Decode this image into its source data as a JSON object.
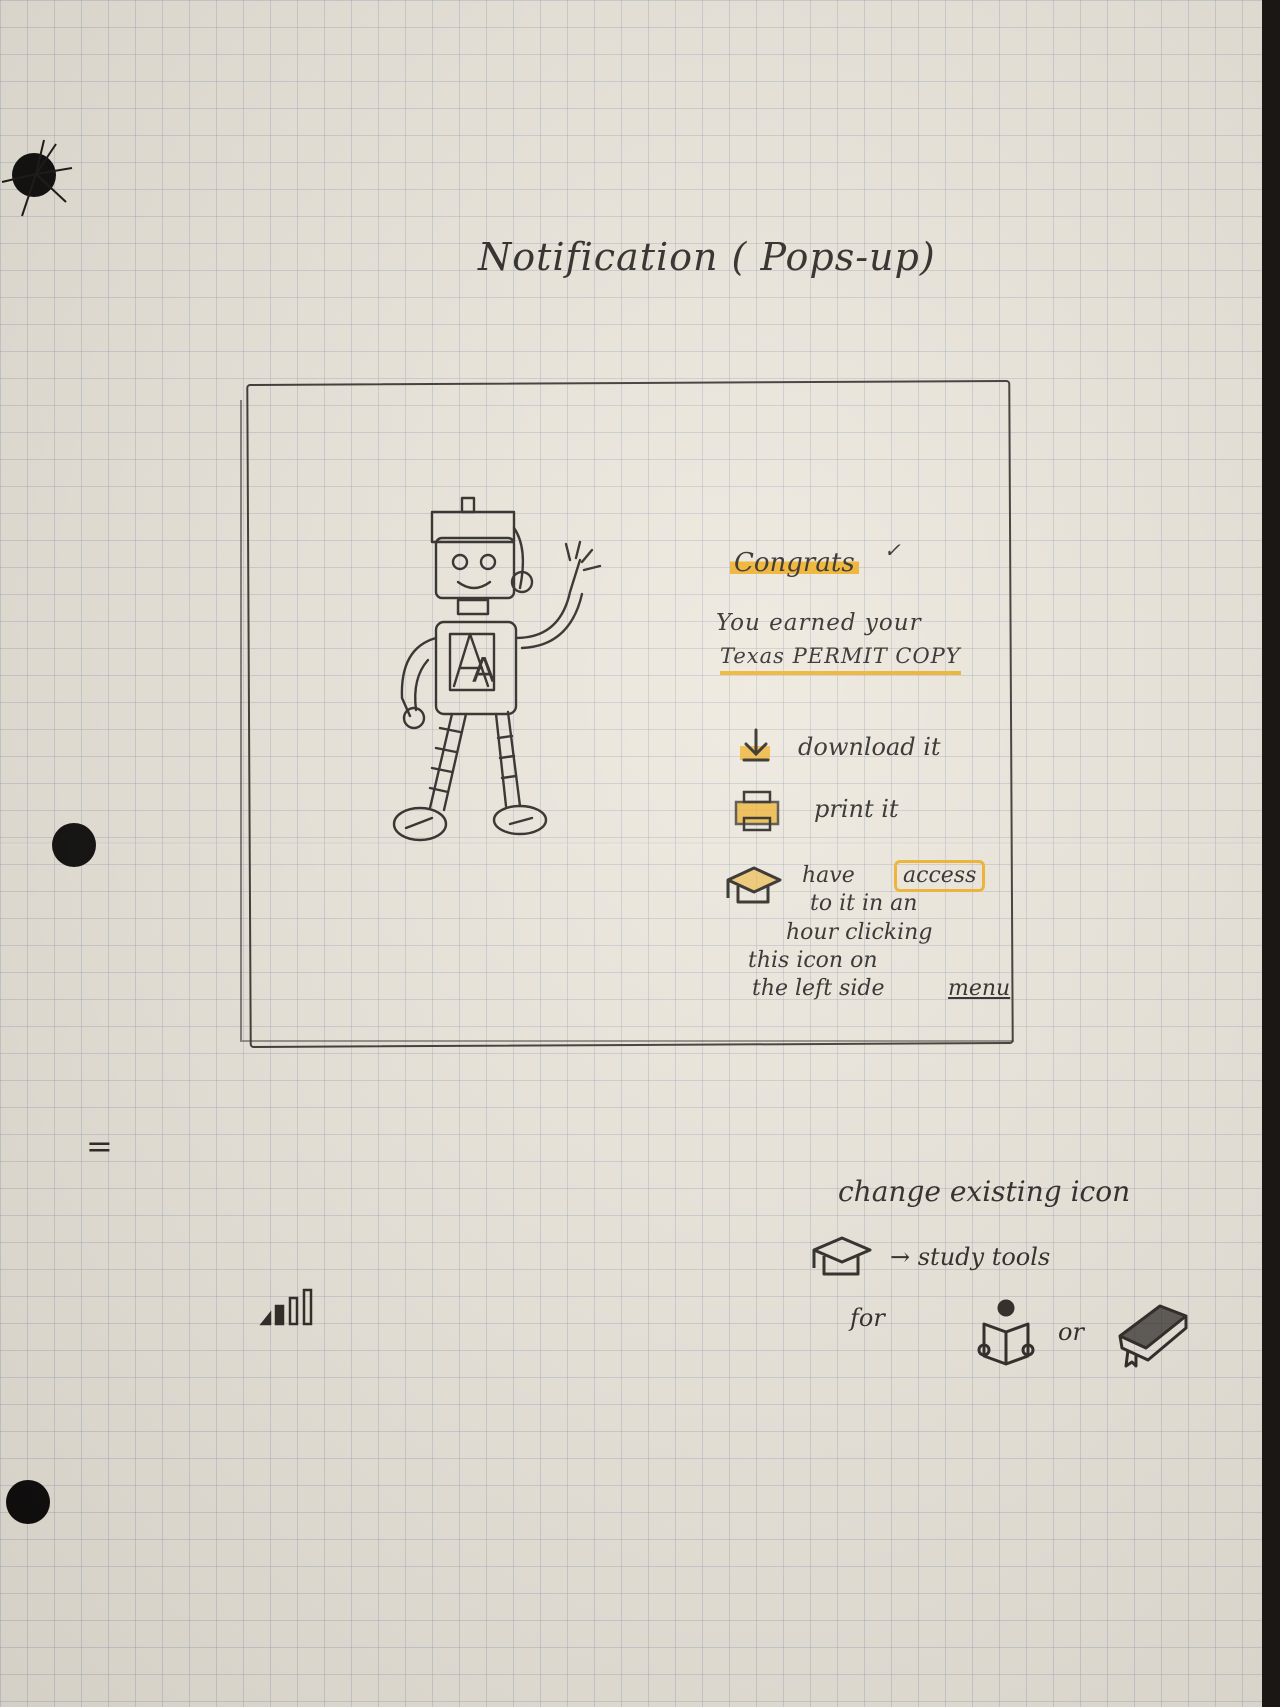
{
  "sketch": {
    "title": "Notification ( Pops-up)",
    "popup": {
      "heading": "Congrats",
      "heading_mark": "✓",
      "message_line1": "You earned your",
      "message_line2": "Texas PERMIT COPY",
      "option_download": "download it",
      "option_print": "print it",
      "option_access_prefix": "have",
      "option_access_word": "access",
      "option_access_line2": "to it in an",
      "option_access_line3": "hour clicking",
      "option_access_line4": "this icon on",
      "option_access_line5": "the left side",
      "option_access_menu": "menu",
      "robot_badge": "A"
    },
    "side_mark": "=",
    "note": {
      "line1": "change existing icon",
      "line2": "→ study tools",
      "line3": "for",
      "line4": "or"
    }
  },
  "colors": {
    "paper": "#ede8dd",
    "ink": "#2a2622",
    "highlighter": "#f0b12a"
  },
  "icons": [
    "download-icon",
    "printer-icon",
    "graduation-cap-icon",
    "reading-person-icon",
    "book-icon",
    "signal-bars-icon"
  ]
}
